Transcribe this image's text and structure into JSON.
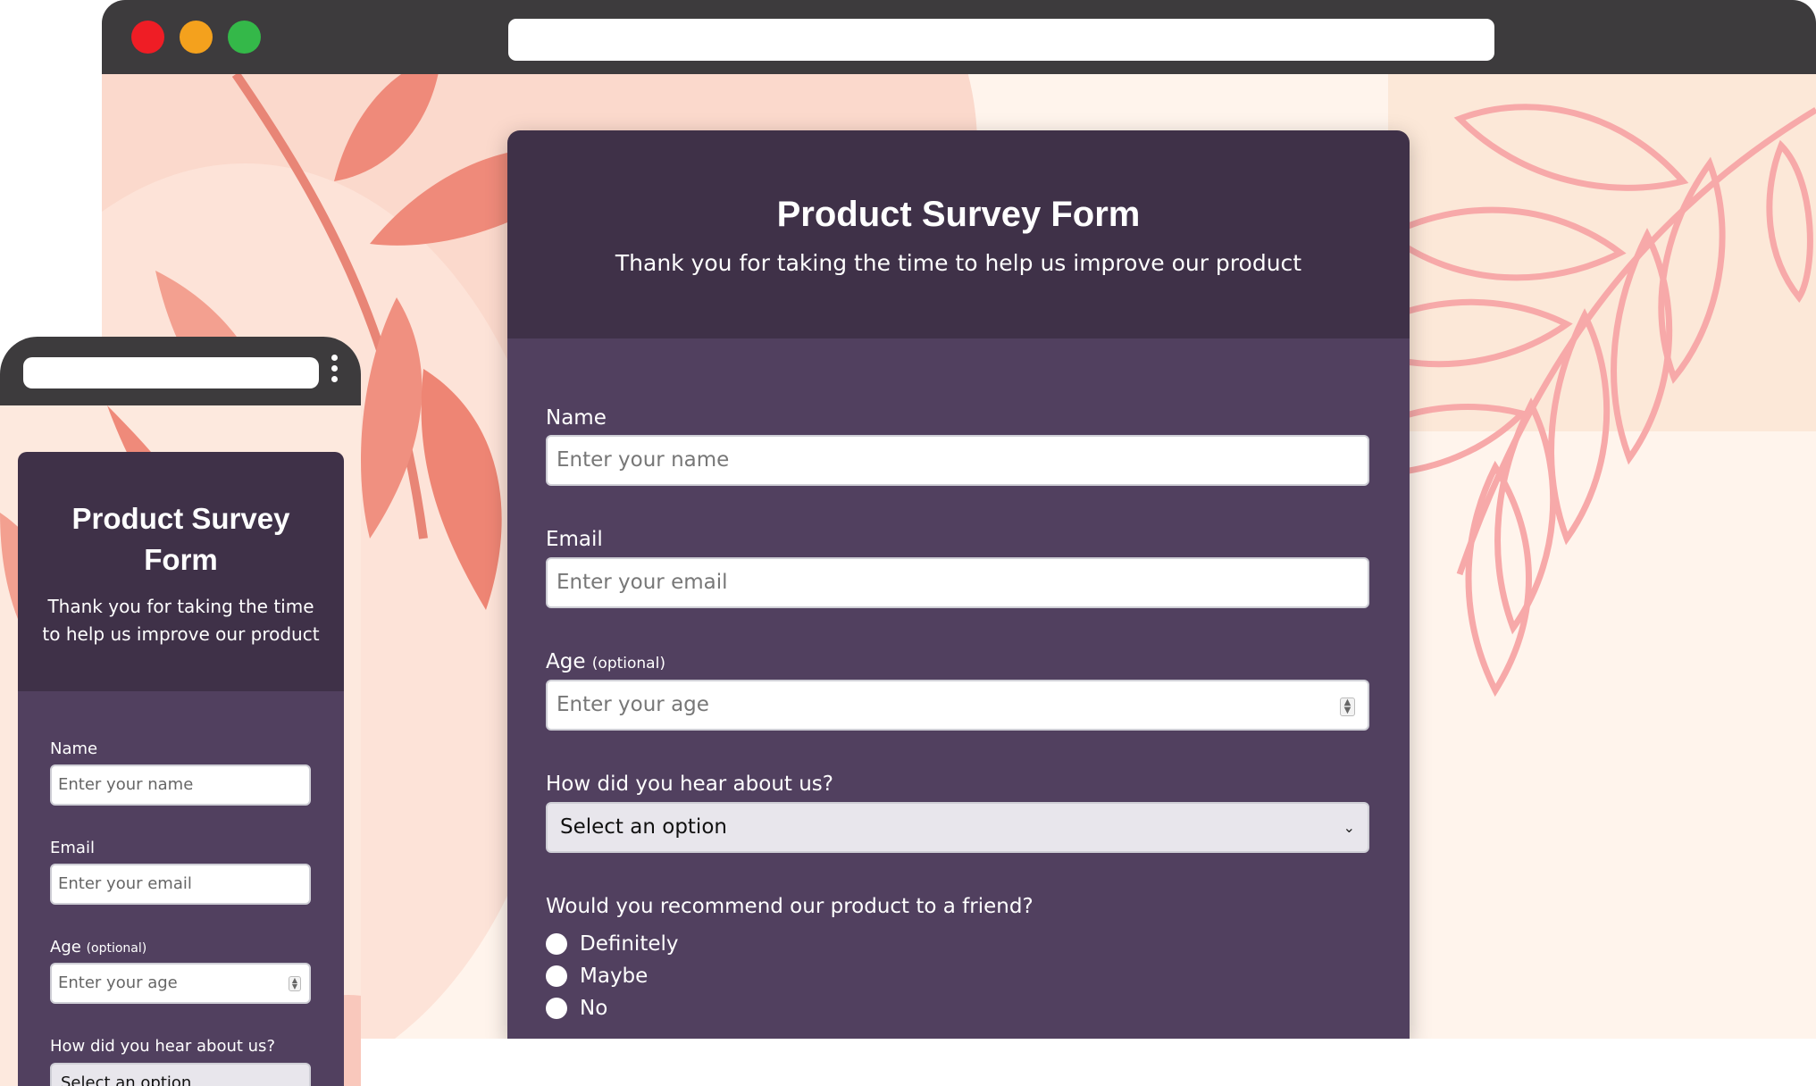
{
  "desktop": {
    "window_controls": [
      "close-dot",
      "minimize-dot",
      "maximize-dot"
    ],
    "address_bar_value": "",
    "form": {
      "title": "Product Survey Form",
      "subtitle": "Thank you for taking the time to help us improve our product",
      "name": {
        "label": "Name",
        "placeholder": "Enter your name"
      },
      "email": {
        "label": "Email",
        "placeholder": "Enter your email"
      },
      "age": {
        "label": "Age",
        "label_note": "(optional)",
        "placeholder": "Enter your age"
      },
      "hear": {
        "label": "How did you hear about us?",
        "selected": "Select an option"
      },
      "recommend": {
        "label": "Would you recommend our product to a friend?",
        "options": [
          "Definitely",
          "Maybe",
          "No"
        ]
      }
    }
  },
  "mobile": {
    "form": {
      "title_line1": "Product Survey",
      "title_line2": "Form",
      "subtitle_line1": "Thank you for taking the time",
      "subtitle_line2": "to help us improve our product",
      "name": {
        "label": "Name",
        "placeholder": "Enter your name"
      },
      "email": {
        "label": "Email",
        "placeholder": "Enter your email"
      },
      "age": {
        "label": "Age",
        "label_note": "(optional)",
        "placeholder": "Enter your age"
      },
      "hear": {
        "label": "How did you hear about us?",
        "selected": "Select an option"
      }
    }
  },
  "colors": {
    "titlebar": "#3d3b3d",
    "close": "#ef1d25",
    "minimize": "#f4a11d",
    "maximize": "#34b849",
    "card_header": "#3f3148",
    "card_body": "#51405f",
    "leaf_coral": "#ef8a7a",
    "leaf_pink_outline": "#f7a9a9"
  }
}
